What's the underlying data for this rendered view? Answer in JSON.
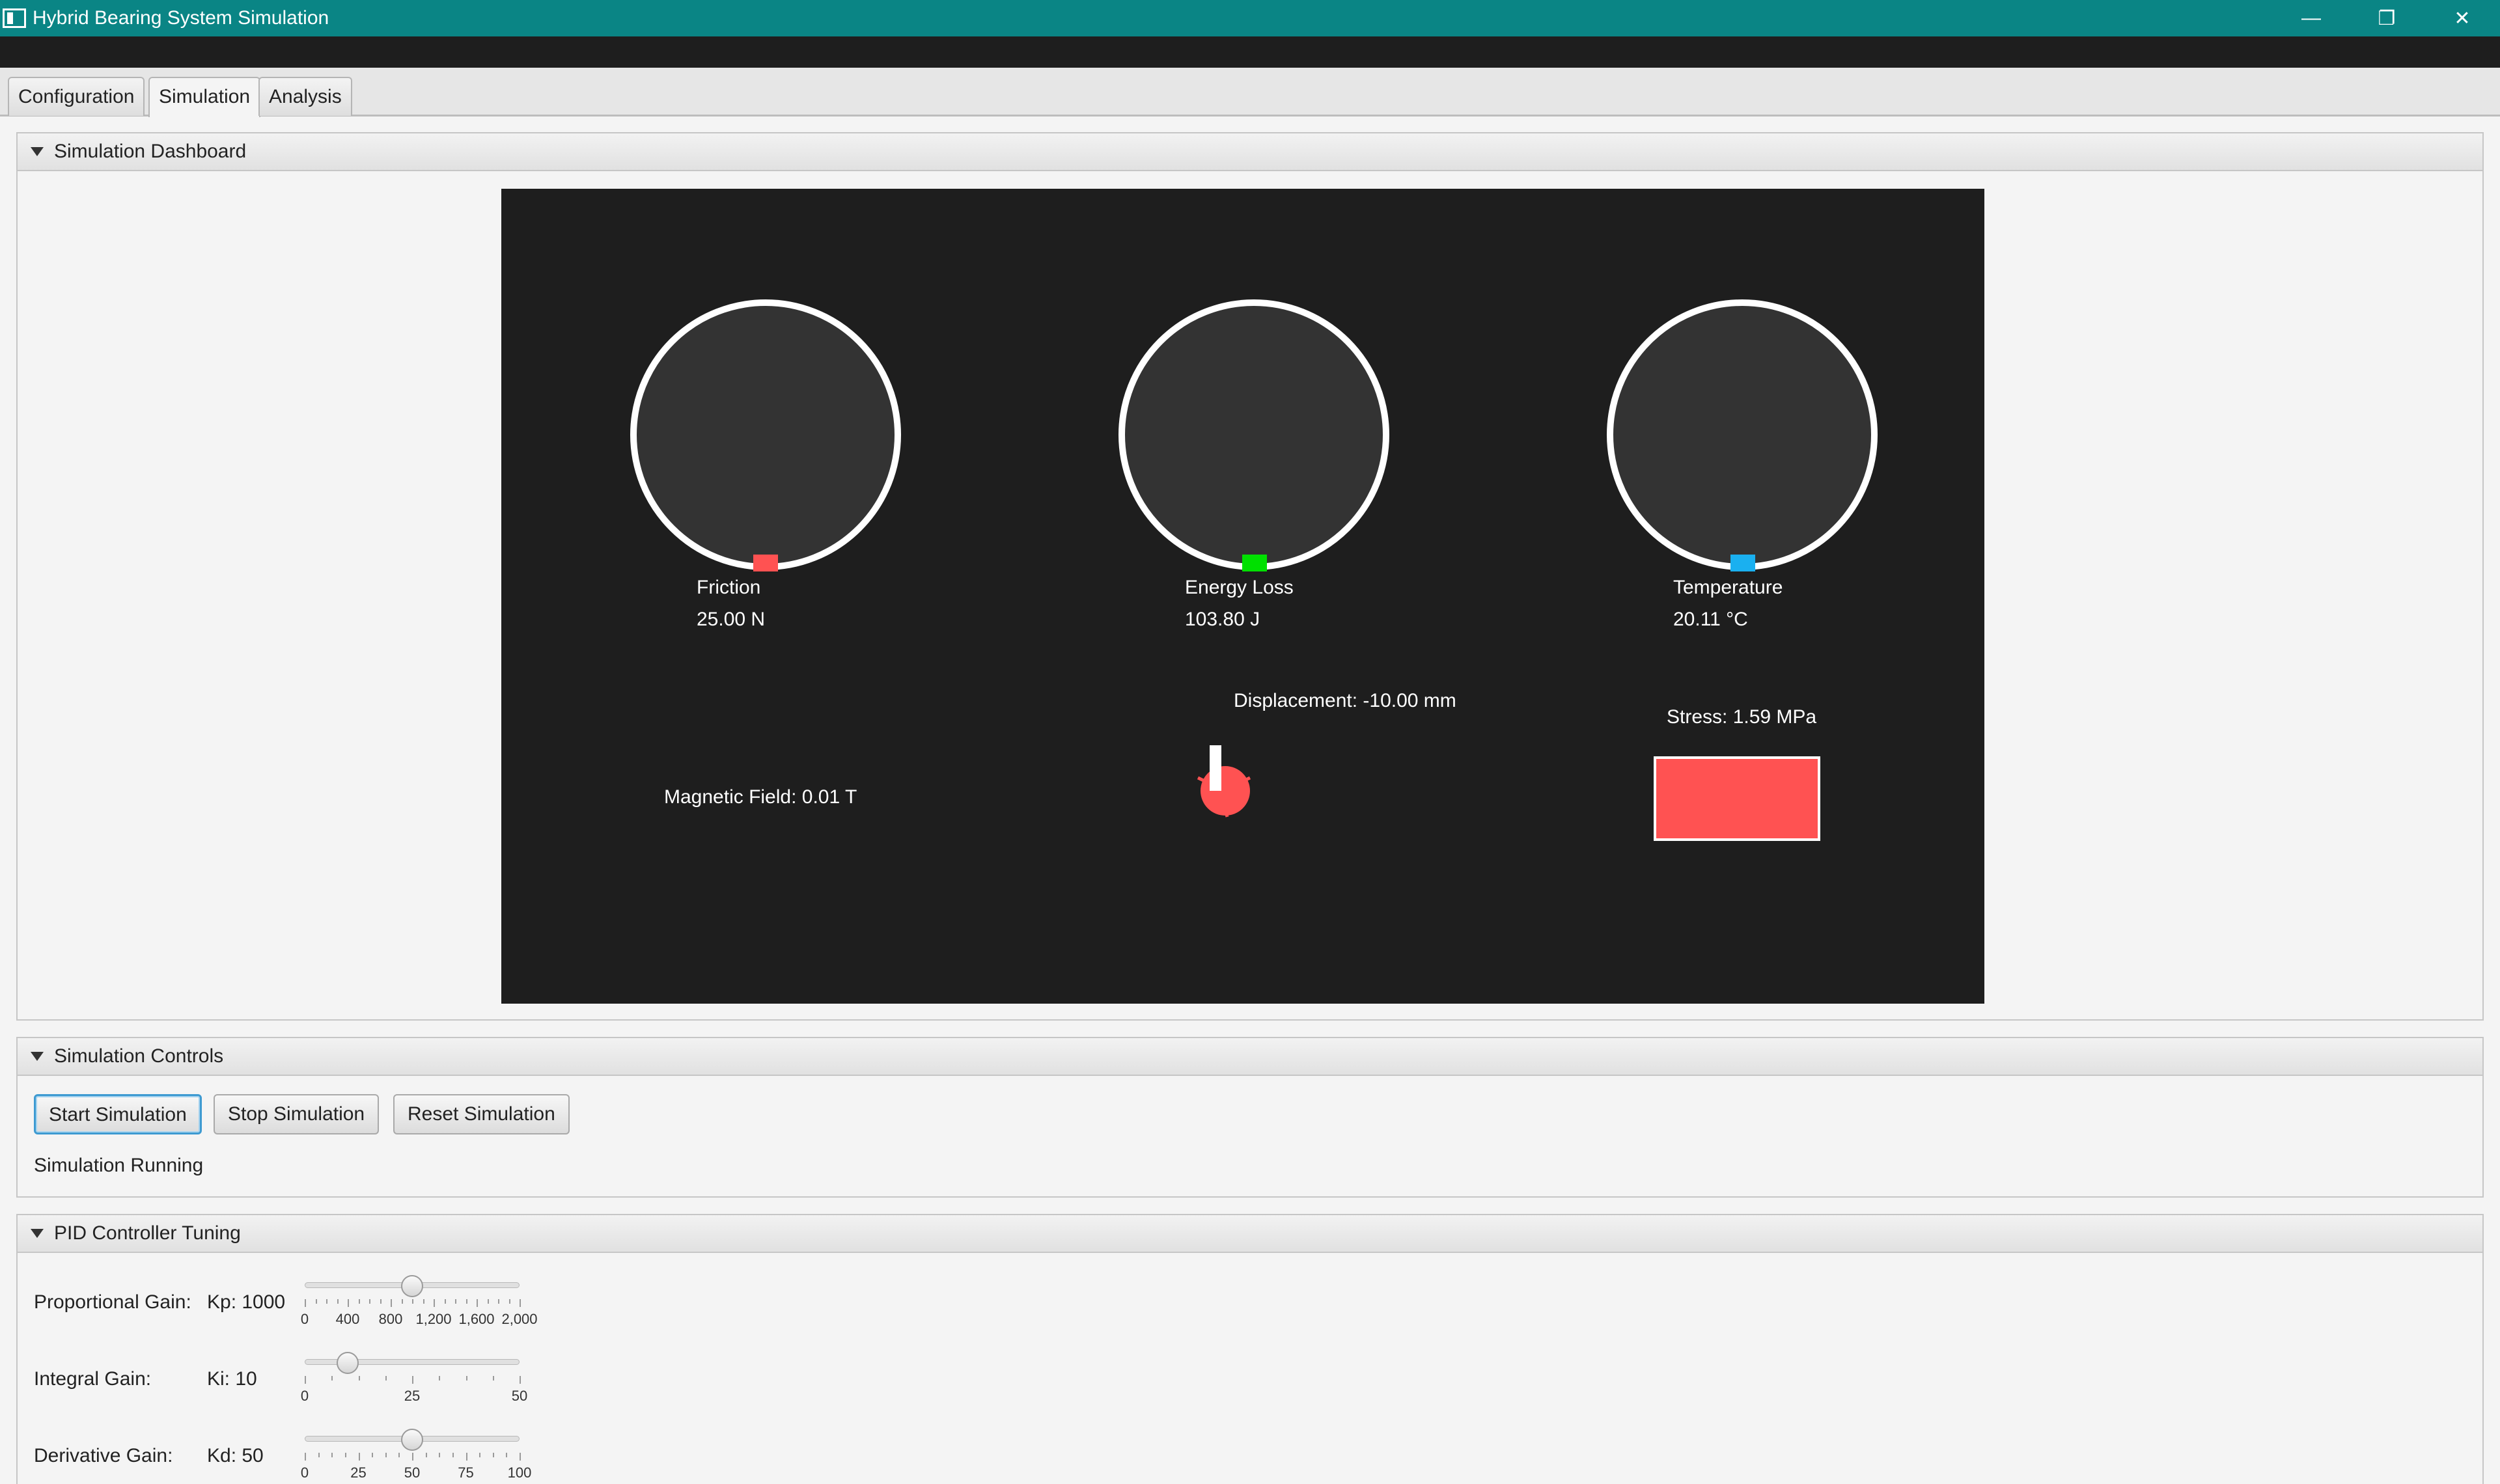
{
  "window": {
    "title": "Hybrid Bearing System Simulation",
    "minimize": "—",
    "restore": "❐",
    "close": "✕"
  },
  "tabs": [
    {
      "label": "Configuration"
    },
    {
      "label": "Simulation"
    },
    {
      "label": "Analysis"
    }
  ],
  "active_tab": "Simulation",
  "dashboard": {
    "header": "Simulation Dashboard",
    "gauges": [
      {
        "label": "Friction",
        "value": "25.00 N",
        "color": "#ff5252"
      },
      {
        "label": "Energy Loss",
        "value": "103.80 J",
        "color": "#00e000"
      },
      {
        "label": "Temperature",
        "value": "20.11 °C",
        "color": "#1ab0f0"
      }
    ],
    "magnetic_field": "Magnetic Field: 0.01 T",
    "displacement": "Displacement: -10.00 mm",
    "stress": "Stress: 1.59 MPa",
    "stress_color": "#ff5252"
  },
  "controls": {
    "header": "Simulation Controls",
    "start": "Start Simulation",
    "stop": "Stop Simulation",
    "reset": "Reset Simulation",
    "status": "Simulation Running"
  },
  "pid": {
    "header": "PID Controller Tuning",
    "rows": [
      {
        "label": "Proportional Gain:",
        "value": "Kp: 1000",
        "min": 0,
        "max": 2000,
        "current": 1000,
        "tick_labels": [
          "0",
          "400",
          "800",
          "1,200",
          "1,600",
          "2,000"
        ]
      },
      {
        "label": "Integral Gain:",
        "value": "Ki: 10",
        "min": 0,
        "max": 50,
        "current": 10,
        "tick_labels": [
          "0",
          "25",
          "50"
        ]
      },
      {
        "label": "Derivative Gain:",
        "value": "Kd: 50",
        "min": 0,
        "max": 100,
        "current": 50,
        "tick_labels": [
          "0",
          "25",
          "50",
          "75",
          "100"
        ]
      }
    ]
  }
}
